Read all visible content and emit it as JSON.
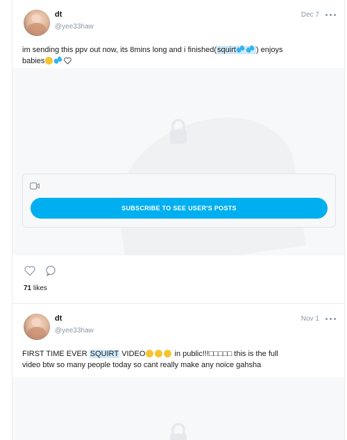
{
  "posts": [
    {
      "author_name": "dt",
      "author_handle": "@yee33haw",
      "date": "Dec 7",
      "text_parts": {
        "before": "im sending this ppv out now, its 8mins long and i finished(",
        "highlight": "squirt",
        "after1": ") enjoys",
        "line2": "babies"
      },
      "subscribe_label": "SUBSCRIBE TO SEE USER'S POSTS",
      "likes_count": "71",
      "likes_label": "likes"
    },
    {
      "author_name": "dt",
      "author_handle": "@yee33haw",
      "date": "Nov 1",
      "text_parts": {
        "before": "FIRST TIME EVER ",
        "highlight": "SQUIRT",
        "after1": " VIDEO",
        "after2": " in public!!!□□□□□ this is the full",
        "line2": "video btw so many people today so cant really make any noice gahsha"
      }
    }
  ],
  "icons": {
    "more": "more-horizontal-icon",
    "lock": "lock-icon",
    "video": "video-camera-icon",
    "like": "heart-icon",
    "comment": "comment-icon"
  },
  "colors": {
    "accent": "#00aff0",
    "highlight": "#cfe9fb",
    "muted": "#8a96a3"
  }
}
